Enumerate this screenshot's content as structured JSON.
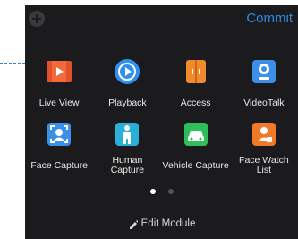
{
  "header": {
    "add_icon": "plus-circle-icon",
    "commit_label": "Commit"
  },
  "modules": [
    {
      "label": "Live View",
      "icon": "live-view-icon",
      "color": "#f06a3a"
    },
    {
      "label": "Playback",
      "icon": "playback-icon",
      "color": "#2f8ff0"
    },
    {
      "label": "Access",
      "icon": "access-door-icon",
      "color": "#f08a2a"
    },
    {
      "label": "VideoTalk",
      "icon": "videotalk-icon",
      "color": "#3b8fe8"
    },
    {
      "label": "Face Capture",
      "icon": "face-capture-icon",
      "color": "#3a8fe8"
    },
    {
      "label": "Human\nCapture",
      "icon": "human-capture-icon",
      "color": "#2ab0d8"
    },
    {
      "label": "Vehicle Capture",
      "icon": "vehicle-capture-icon",
      "color": "#2fbf5a"
    },
    {
      "label": "Face Watch\nList",
      "icon": "face-watch-list-icon",
      "color": "#f07a2a"
    }
  ],
  "pagination": {
    "pages": 2,
    "current": 1
  },
  "footer": {
    "edit_label": "Edit Module",
    "edit_icon": "pencil-icon"
  }
}
